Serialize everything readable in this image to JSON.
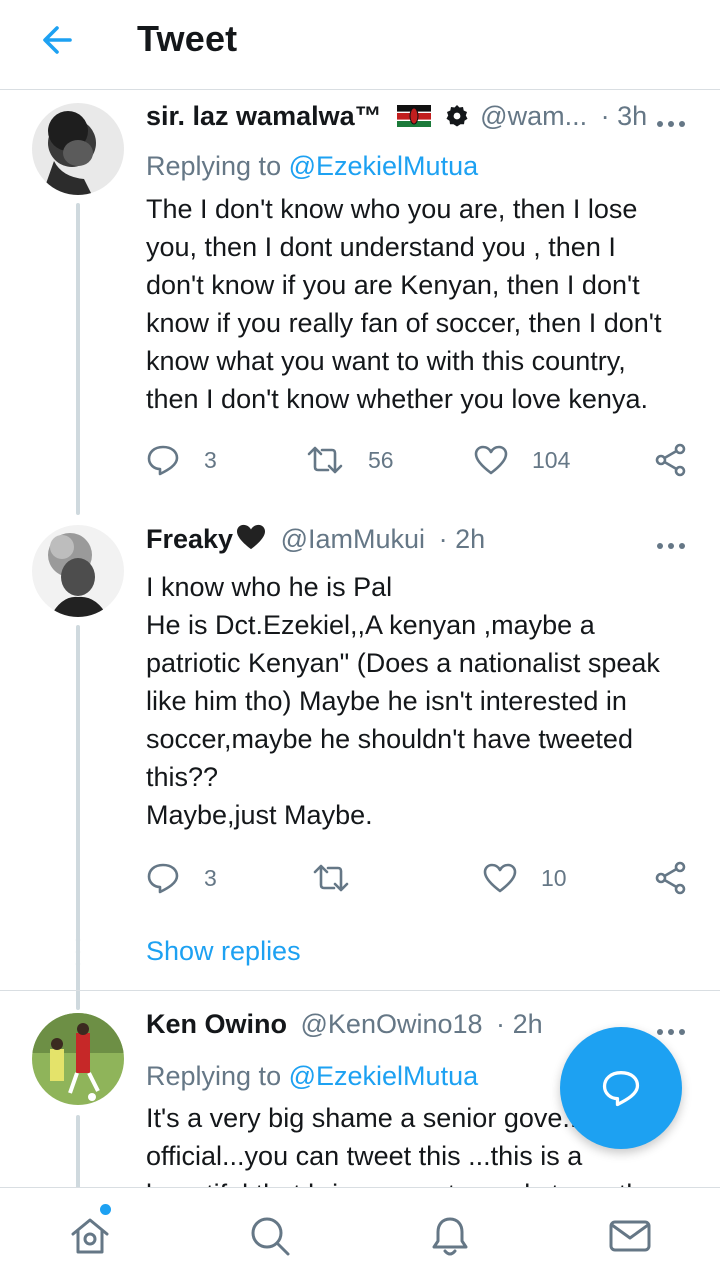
{
  "header": {
    "title": "Tweet",
    "back_icon": "arrow-left-icon"
  },
  "colors": {
    "accent": "#1da1f2",
    "muted": "#657786",
    "text": "#14171a",
    "divider": "#d9dee2"
  },
  "tweets": [
    {
      "name": "sir. laz wamalwa™",
      "badges": [
        "kenya-flag-icon",
        "verified-badge-icon"
      ],
      "handle": "@wam...",
      "dot": "·",
      "time": "3h",
      "replying_prefix": "Replying to",
      "replying_to": "@EzekielMutua",
      "text": "The I don't know who you are, then I lose\nyou, then I dont understand you , then I\ndon't know if you are Kenyan, then I don't\nknow if you really fan of soccer, then I don't\nknow what you want to with this country,\nthen I don't know whether you love kenya.",
      "replies": "3",
      "retweets": "56",
      "likes": "104"
    },
    {
      "name": "Freaky",
      "name_emoji": "🖤",
      "handle": "@IamMukui",
      "dot": "·",
      "time": "2h",
      "text": "I know who he is Pal\nHe is Dct.Ezekiel,,A kenyan ,maybe a\npatriotic Kenyan\" (Does a nationalist speak\nlike him tho) Maybe he isn't interested in\nsoccer,maybe he shouldn't have tweeted\nthis??\nMaybe,just Maybe.",
      "replies": "3",
      "retweets": "",
      "likes": "10"
    },
    {
      "name": "Ken Owino",
      "handle": "@KenOwino18",
      "dot": "·",
      "time": "2h",
      "replying_prefix": "Replying to",
      "replying_to": "@EzekielMutua",
      "text": "It's a very big shame a senior gove...\nofficial...you can tweet this ...this is a\nbeautiful that brings country and stamp the"
    }
  ],
  "show_replies": "Show replies",
  "fab": {
    "icon": "compose-reply-icon"
  },
  "bottom_nav": [
    "home-icon",
    "search-icon",
    "notifications-icon",
    "messages-icon"
  ]
}
